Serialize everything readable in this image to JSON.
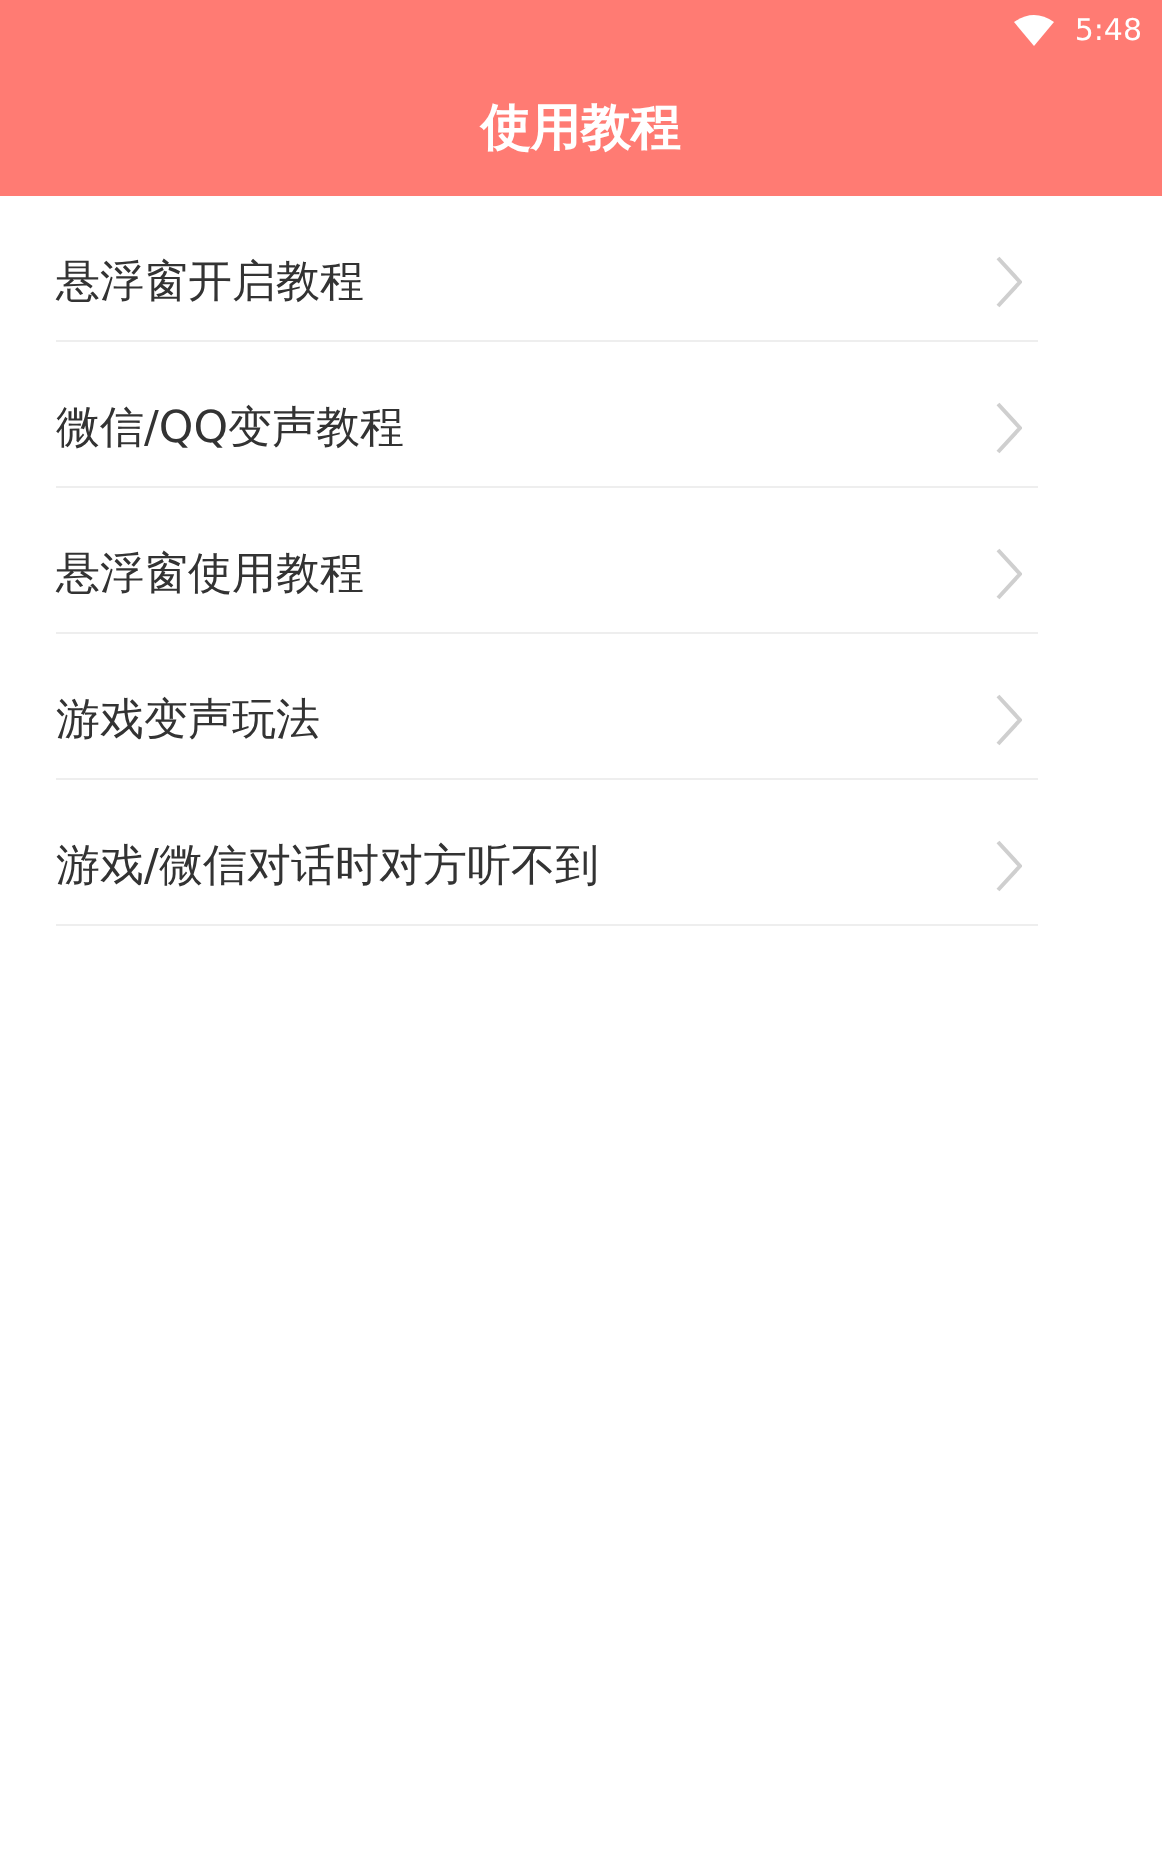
{
  "status_bar": {
    "time": "5:48"
  },
  "header": {
    "title": "使用教程"
  },
  "items": [
    {
      "label": "悬浮窗开启教程"
    },
    {
      "label": "微信/QQ变声教程"
    },
    {
      "label": "悬浮窗使用教程"
    },
    {
      "label": "游戏变声玩法"
    },
    {
      "label": "游戏/微信对话时对方听不到"
    }
  ]
}
